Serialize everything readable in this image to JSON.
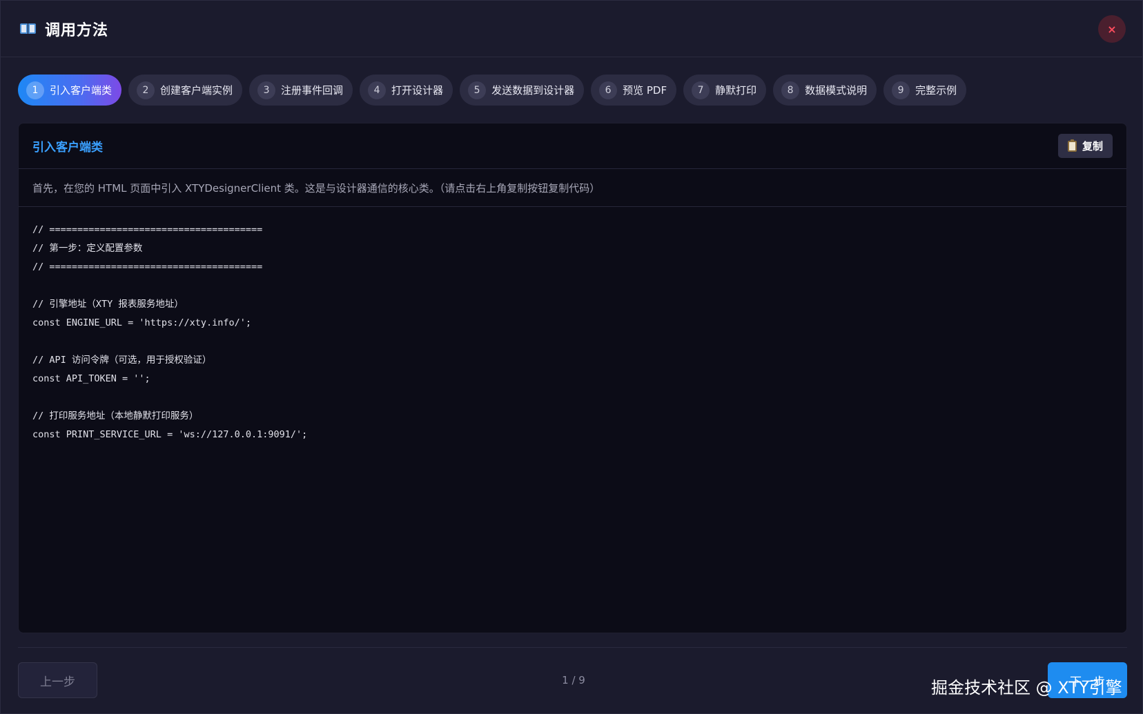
{
  "header": {
    "title": "调用方法",
    "close_label": "×"
  },
  "steps": [
    {
      "num": "1",
      "label": "引入客户端类",
      "active": true
    },
    {
      "num": "2",
      "label": "创建客户端实例"
    },
    {
      "num": "3",
      "label": "注册事件回调"
    },
    {
      "num": "4",
      "label": "打开设计器"
    },
    {
      "num": "5",
      "label": "发送数据到设计器"
    },
    {
      "num": "6",
      "label": "预览 PDF"
    },
    {
      "num": "7",
      "label": "静默打印"
    },
    {
      "num": "8",
      "label": "数据模式说明"
    },
    {
      "num": "9",
      "label": "完整示例"
    }
  ],
  "panel": {
    "title": "引入客户端类",
    "copy_label": "复制",
    "description": "首先，在您的 HTML 页面中引入 XTYDesignerClient 类。这是与设计器通信的核心类。（请点击右上角复制按钮复制代码）",
    "code_lines": [
      "// ======================================",
      "// 第一步：定义配置参数",
      "// ======================================",
      "",
      "// 引擎地址（XTY 报表服务地址）",
      "const ENGINE_URL = 'https://xty.info/';",
      "",
      "// API 访问令牌（可选，用于授权验证）",
      "const API_TOKEN = '';",
      "",
      "// 打印服务地址（本地静默打印服务）",
      "const PRINT_SERVICE_URL = 'ws://127.0.0.1:9091/';"
    ]
  },
  "footer": {
    "prev_label": "上一步",
    "page_indicator": "1 / 9",
    "next_label": "下一步",
    "watermark": "掘金技术社区 @ XTY引擎"
  }
}
